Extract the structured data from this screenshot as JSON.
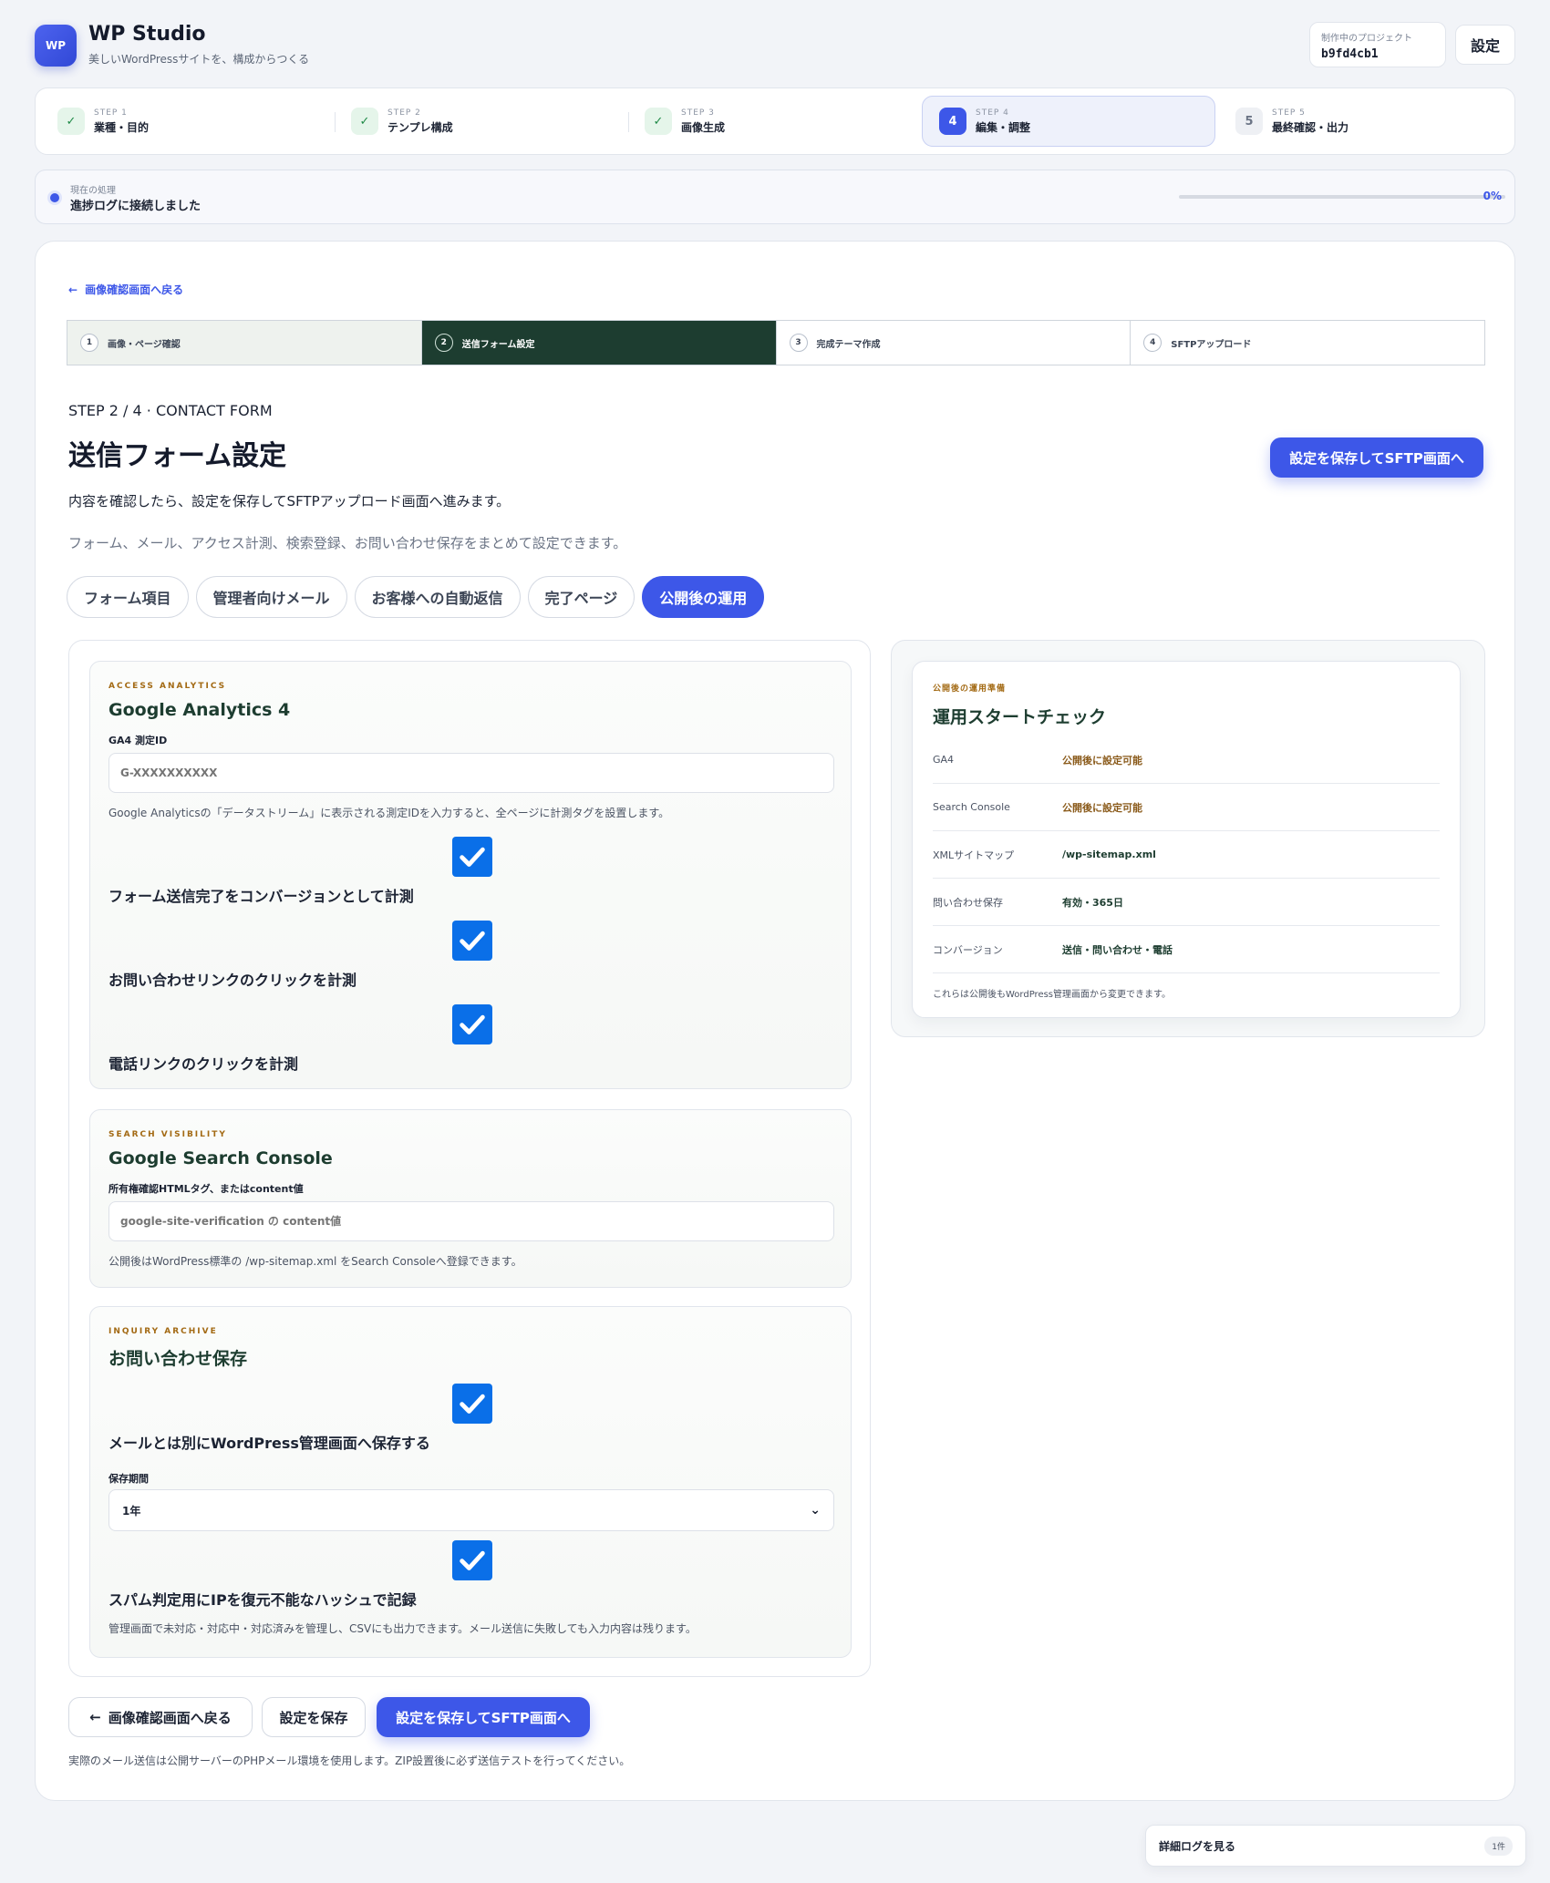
{
  "header": {
    "logo_text": "WP",
    "app_title": "WP Studio",
    "app_subtitle": "美しいWordPressサイトを、構成からつくる",
    "project_caption": "制作中のプロジェクト",
    "project_id": "b9fd4cb1",
    "settings_label": "設定"
  },
  "steps": [
    {
      "cap": "STEP 1",
      "label": "業種・目的",
      "status": "done"
    },
    {
      "cap": "STEP 2",
      "label": "テンプレ構成",
      "status": "done"
    },
    {
      "cap": "STEP 3",
      "label": "画像生成",
      "status": "done"
    },
    {
      "cap": "STEP 4",
      "label": "編集・調整",
      "status": "active",
      "num": "4"
    },
    {
      "cap": "STEP 5",
      "label": "最終確認・出力",
      "status": "todo",
      "num": "5"
    }
  ],
  "progress": {
    "caption": "現在の処理",
    "text": "進捗ログに接続しました",
    "percent_label": "0%",
    "value": 0
  },
  "main": {
    "back_link": "画像確認画面へ戻る",
    "substeps": [
      {
        "num": "1",
        "label": "画像・ページ確認"
      },
      {
        "num": "2",
        "label": "送信フォーム設定"
      },
      {
        "num": "3",
        "label": "完成テーマ作成"
      },
      {
        "num": "4",
        "label": "SFTPアップロード"
      }
    ],
    "kicker": "STEP 2 / 4 · CONTACT FORM",
    "title": "送信フォーム設定",
    "desc1": "内容を確認したら、設定を保存してSFTPアップロード画面へ進みます。",
    "desc2": "フォーム、メール、アクセス計測、検索登録、お問い合わせ保存をまとめて設定できます。",
    "cta_top": "設定を保存してSFTP画面へ",
    "tabs": [
      "フォーム項目",
      "管理者向けメール",
      "お客様への自動返信",
      "完了ページ",
      "公開後の運用"
    ]
  },
  "analytics": {
    "kicker": "ACCESS ANALYTICS",
    "title": "Google Analytics 4",
    "field_label": "GA4 測定ID",
    "placeholder": "G-XXXXXXXXXX",
    "help": "Google Analyticsの「データストリーム」に表示される測定IDを入力すると、全ページに計測タグを設置します。",
    "cb1": "フォーム送信完了をコンバージョンとして計測",
    "cb2": "お問い合わせリンクのクリックを計測",
    "cb3": "電話リンクのクリックを計測"
  },
  "search": {
    "kicker": "SEARCH VISIBILITY",
    "title": "Google Search Console",
    "field_label": "所有権確認HTMLタグ、またはcontent値",
    "placeholder": "google-site-verification の content値",
    "help": "公開後はWordPress標準の /wp-sitemap.xml をSearch Consoleへ登録できます。"
  },
  "archive": {
    "kicker": "INQUIRY ARCHIVE",
    "title": "お問い合わせ保存",
    "cb1": "メールとは別にWordPress管理画面へ保存する",
    "period_label": "保存期間",
    "period_value": "1年",
    "cb2": "スパム判定用にIPを復元不能なハッシュで記録",
    "help": "管理画面で未対応・対応中・対応済みを管理し、CSVにも出力できます。メール送信に失敗しても入力内容は残ります。"
  },
  "summary": {
    "kicker": "公開後の運用準備",
    "title": "運用スタートチェック",
    "rows": [
      {
        "k": "GA4",
        "v": "公開後に設定可能",
        "color": "#8a5a1a"
      },
      {
        "k": "Search Console",
        "v": "公開後に設定可能",
        "color": "#8a5a1a"
      },
      {
        "k": "XMLサイトマップ",
        "v": "/wp-sitemap.xml",
        "color": "#1d3d30"
      },
      {
        "k": "問い合わせ保存",
        "v": "有効・365日",
        "color": "#1d3d30"
      },
      {
        "k": "コンバージョン",
        "v": "送信・問い合わせ・電話",
        "color": "#1d3d30"
      }
    ],
    "note": "これらは公開後もWordPress管理画面から変更できます。"
  },
  "bottom": {
    "back": "画像確認画面へ戻る",
    "save": "設定を保存",
    "save_next": "設定を保存してSFTP画面へ",
    "footnote": "実際のメール送信は公開サーバーのPHPメール環境を使用します。ZIP設置後に必ず送信テストを行ってください。"
  },
  "log": {
    "label": "詳細ログを見る",
    "count": "1件"
  }
}
